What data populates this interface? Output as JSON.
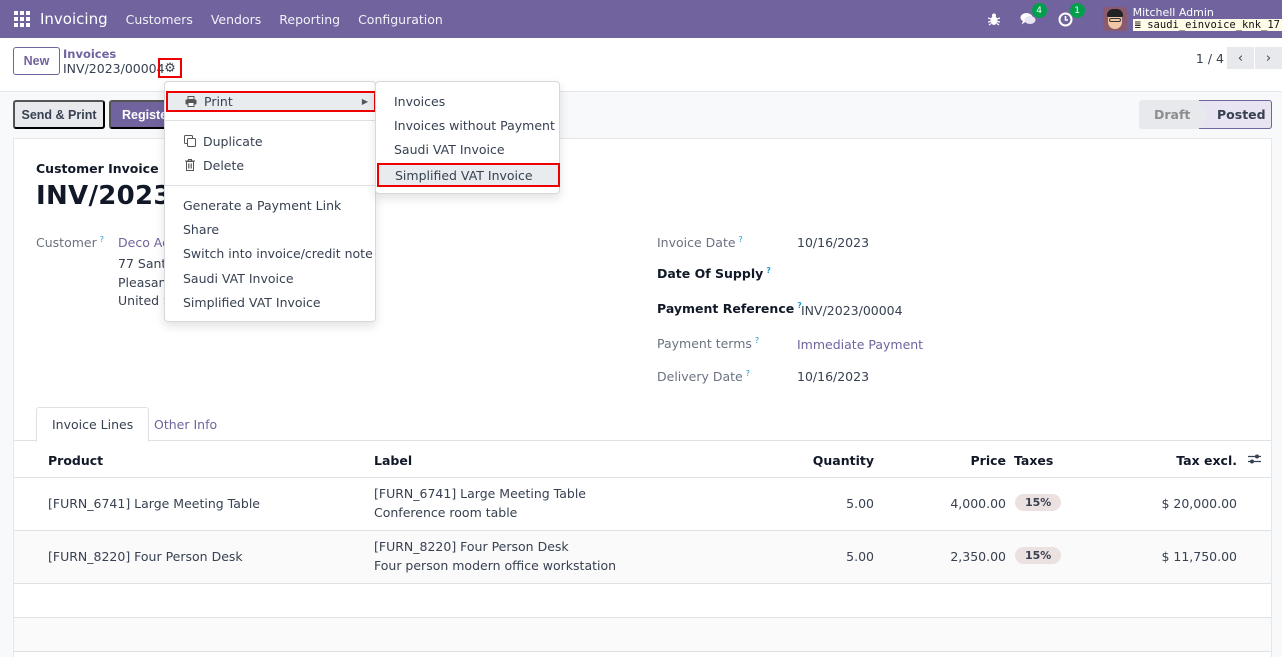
{
  "navbar": {
    "app_name": "Invoicing",
    "menu": [
      "Customers",
      "Vendors",
      "Reporting",
      "Configuration"
    ],
    "messages_count": "4",
    "activities_count": "1",
    "user_name": "Mitchell Admin",
    "database": "saudi_einvoice_knk_17"
  },
  "control": {
    "new_label": "New",
    "breadcrumb_parent": "Invoices",
    "breadcrumb_current": "INV/2023/00004",
    "pager": "1 / 4"
  },
  "actions": {
    "send_print": "Send & Print",
    "register_payment": "Register Payment"
  },
  "statusbar": {
    "states": [
      "Draft",
      "Posted"
    ],
    "current": "Posted"
  },
  "form": {
    "doc_type": "Customer Invoice",
    "title": "INV/2023/00004",
    "customer_label": "Customer",
    "customer_name": "Deco Addict",
    "customer_address": [
      "77 Santa Barbara Rd",
      "Pleasant Hill CA 94523",
      "United States"
    ],
    "invoice_date_label": "Invoice Date",
    "invoice_date": "10/16/2023",
    "date_of_supply_label": "Date Of Supply",
    "payment_reference_label": "Payment Reference",
    "payment_reference": "INV/2023/00004",
    "payment_terms_label": "Payment terms",
    "payment_terms": "Immediate Payment",
    "delivery_date_label": "Delivery Date",
    "delivery_date": "10/16/2023",
    "help_mark": "?"
  },
  "tabs": [
    "Invoice Lines",
    "Other Info"
  ],
  "table": {
    "headers": {
      "product": "Product",
      "label": "Label",
      "quantity": "Quantity",
      "price": "Price",
      "taxes": "Taxes",
      "tax_excl": "Tax excl."
    },
    "rows": [
      {
        "product": "[FURN_6741] Large Meeting Table",
        "label_line1": "[FURN_6741] Large Meeting Table",
        "label_line2": "Conference room table",
        "quantity": "5.00",
        "price": "4,000.00",
        "tax": "15%",
        "subtotal": "$ 20,000.00"
      },
      {
        "product": "[FURN_8220] Four Person Desk",
        "label_line1": "[FURN_8220] Four Person Desk",
        "label_line2": "Four person modern office workstation",
        "quantity": "5.00",
        "price": "2,350.00",
        "tax": "15%",
        "subtotal": "$ 11,750.00"
      }
    ]
  },
  "gear_menu": {
    "print": "Print",
    "duplicate": "Duplicate",
    "delete": "Delete",
    "items": [
      "Generate a Payment Link",
      "Share",
      "Switch into invoice/credit note",
      "Saudi VAT Invoice",
      "Simplified VAT Invoice"
    ]
  },
  "print_submenu": [
    "Invoices",
    "Invoices without Payment",
    "Saudi VAT Invoice",
    "Simplified VAT Invoice"
  ],
  "colors": {
    "brand": "#71639e",
    "highlight_border": "#ee0000",
    "badge": "#00a04a"
  }
}
